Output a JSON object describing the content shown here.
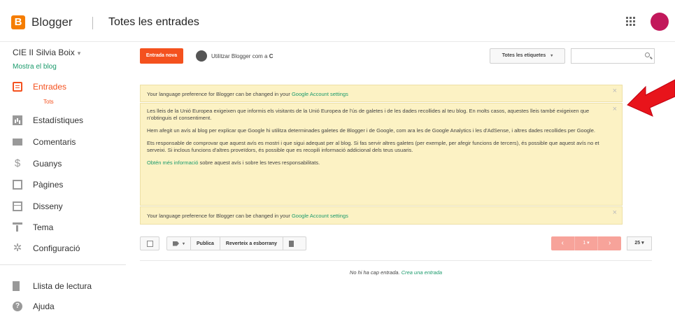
{
  "header": {
    "logo_letter": "B",
    "brand": "Blogger",
    "separator": "|",
    "title": "Totes les entrades"
  },
  "sidebar": {
    "blog_name": "CIE II Silvia Boix",
    "blog_caret": "▾",
    "view_blog": "Mostra el blog",
    "items": [
      {
        "label": "Entrades",
        "icon": "posts-icon"
      },
      {
        "label": "Estadístiques",
        "icon": "stats-icon"
      },
      {
        "label": "Comentaris",
        "icon": "comment-icon"
      },
      {
        "label": "Guanys",
        "icon": "dollar-icon"
      },
      {
        "label": "Pàgines",
        "icon": "pages-icon"
      },
      {
        "label": "Disseny",
        "icon": "layout-icon"
      },
      {
        "label": "Tema",
        "icon": "theme-icon"
      },
      {
        "label": "Configuració",
        "icon": "gear-icon"
      }
    ],
    "sub_item": "Tots",
    "bottom_items": [
      {
        "label": "Llista de lectura",
        "icon": "bookmark-icon"
      },
      {
        "label": "Ajuda",
        "icon": "help-icon"
      }
    ]
  },
  "toolbar": {
    "new_post": "Entrada nova",
    "use_blogger_as": "Utilitzar Blogger com a",
    "use_blogger_as_suffix": "C",
    "labels_dropdown": "Totes les etiquetes",
    "dropdown_caret": "▾",
    "search_placeholder": ""
  },
  "notices": {
    "lang_text": "Your language preference for Blogger can be changed in your",
    "lang_link": "Google Account settings",
    "close": "×",
    "cookie_p1": "Les lleis de la Unió Europea exigeixen que informis els visitants de la Unió Europea de l'ús de galetes i de les dades recollides al teu blog. En molts casos, aquestes lleis també exigeixen que n'obtinguis el consentiment.",
    "cookie_p2": "Hem afegit un avís al blog per explicar que Google hi utilitza determinades galetes de Blogger i de Google, com ara les de Google Analytics i les d'AdSense, i altres dades recollides per Google.",
    "cookie_p3": "Ets responsable de comprovar que aquest avís es mostri i que sigui adequat per al blog. Si fas servir altres galetes (per exemple, per afegir funcions de tercers), és possible que aquest avís no et serveixi. Si inclous funcions d'altres proveïdors, és possible que es recopili informació addicional dels teus usuaris.",
    "more_info_link": "Obtén més informació",
    "more_info_text": "sobre aquest avís i sobre les teves responsabilitats."
  },
  "actions": {
    "publish": "Publica",
    "revert": "Reverteix a esborrany",
    "pager_prev": "‹",
    "pager_mid": "1 ▾",
    "pager_next": "›",
    "per_page": "25 ▾"
  },
  "empty": {
    "text": "No hi ha cap entrada.",
    "link": "Crea una entrada"
  },
  "colors": {
    "accent": "#f4511e",
    "link": "#1a9a6b",
    "notice_bg": "#fcf2c4",
    "arrow": "#e8141b"
  }
}
